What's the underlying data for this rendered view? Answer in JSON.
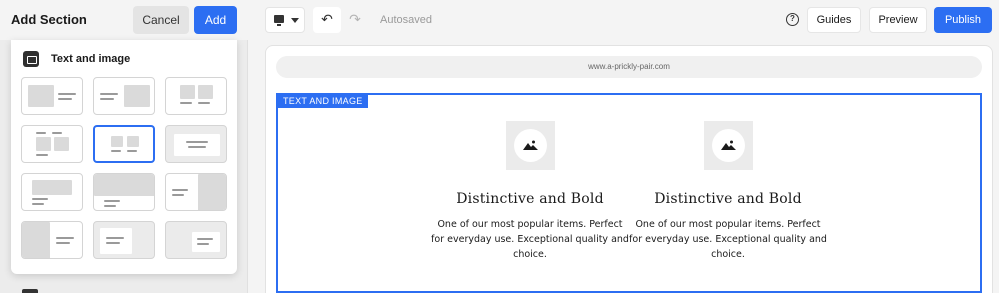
{
  "panel": {
    "title": "Add Section",
    "cancel_label": "Cancel",
    "add_label": "Add",
    "category": {
      "label": "Text and image",
      "icon": "text-image-category-icon"
    },
    "layouts": [
      "image-left-text",
      "text-left-image",
      "two-images-text",
      "two-columns-image-text",
      "centered-images-text",
      "centered-text-box",
      "banner-image-text",
      "full-image-text",
      "text-image-right-half",
      "half-image-text",
      "text-box-on-image",
      "text-box-right-on-image"
    ],
    "selected_layout": "centered-images-text"
  },
  "toolbar": {
    "device_icon": "desktop-icon",
    "undo_icon": "undo-icon",
    "redo_icon": "redo-icon",
    "status": "Autosaved",
    "help_icon": "help-icon",
    "guides_label": "Guides",
    "preview_label": "Preview",
    "publish_label": "Publish"
  },
  "canvas": {
    "url": "www.a-prickly-pair.com",
    "section_tag": "TEXT AND IMAGE",
    "features": [
      {
        "title": "Distinctive and Bold",
        "body": "One of our most popular items. Perfect for everyday use. Exceptional quality and choice."
      },
      {
        "title": "Distinctive and Bold",
        "body": "One of our most popular items. Perfect for everyday use. Exceptional quality and choice."
      }
    ]
  },
  "colors": {
    "accent": "#2c6ef2",
    "panel_bg": "#ececec",
    "toolbar_bg": "#f4f4f4"
  }
}
